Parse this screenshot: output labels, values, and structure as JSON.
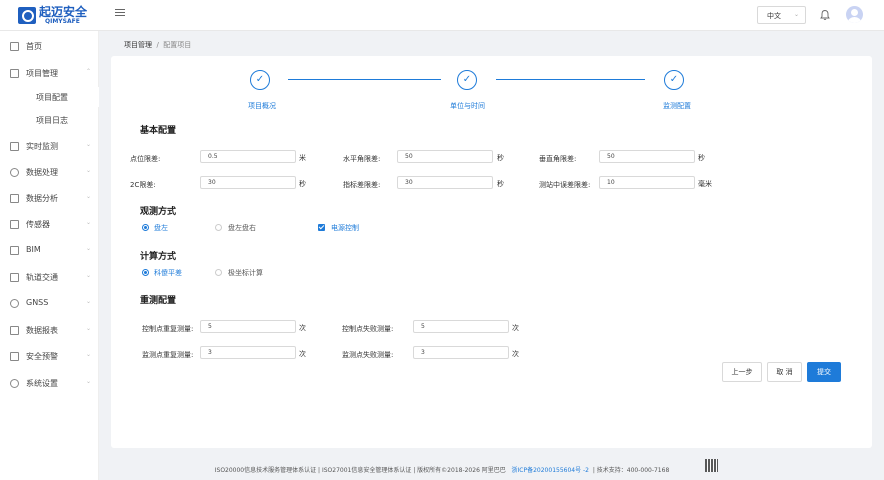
{
  "header": {
    "logo_cn": "起迈安全",
    "logo_en": "QIMYSAFE",
    "language": "中文",
    "icons": [
      "menu-toggle-icon",
      "bell-icon",
      "avatar-icon"
    ]
  },
  "sidebar": {
    "items": [
      {
        "label": "首页",
        "icon": "home-icon"
      },
      {
        "label": "项目管理",
        "icon": "project-icon",
        "expanded": true
      },
      {
        "label": "项目配置",
        "sub": true
      },
      {
        "label": "项目日志",
        "sub": true
      },
      {
        "label": "实时监测",
        "icon": "monitor-icon"
      },
      {
        "label": "数据处理",
        "icon": "data-process-icon"
      },
      {
        "label": "数据分析",
        "icon": "analysis-icon"
      },
      {
        "label": "传感器",
        "icon": "sensor-icon"
      },
      {
        "label": "BIM",
        "icon": "bim-icon"
      },
      {
        "label": "轨道交通",
        "icon": "rail-icon"
      },
      {
        "label": "GNSS",
        "icon": "gnss-icon"
      },
      {
        "label": "数据报表",
        "icon": "report-icon"
      },
      {
        "label": "安全预警",
        "icon": "warning-icon"
      },
      {
        "label": "系统设置",
        "icon": "settings-icon"
      }
    ]
  },
  "breadcrumb": {
    "root": "项目管理",
    "sep": "/",
    "current": "配置项目"
  },
  "steps": [
    {
      "label": "项目概况",
      "done": true
    },
    {
      "label": "单位与时间",
      "done": true
    },
    {
      "label": "监测配置",
      "done": true
    }
  ],
  "basic": {
    "title": "基本配置",
    "fields": [
      {
        "label": "点位限差:",
        "value": "0.5",
        "unit": "米"
      },
      {
        "label": "水平角限差:",
        "value": "50",
        "unit": "秒"
      },
      {
        "label": "垂直角限差:",
        "value": "50",
        "unit": "秒"
      },
      {
        "label": "2C限差:",
        "value": "30",
        "unit": "秒"
      },
      {
        "label": "指标差限差:",
        "value": "30",
        "unit": "秒"
      },
      {
        "label": "测站中误差限差:",
        "value": "10",
        "unit": "毫米"
      }
    ]
  },
  "observe": {
    "title": "观测方式",
    "options": [
      {
        "label": "盘左",
        "selected": true
      },
      {
        "label": "盘左盘右",
        "selected": false
      }
    ],
    "checkbox": {
      "label": "电源控制",
      "checked": true
    }
  },
  "calc": {
    "title": "计算方式",
    "options": [
      {
        "label": "科傻平差",
        "selected": true
      },
      {
        "label": "极坐标计算",
        "selected": false
      }
    ]
  },
  "remeasure": {
    "title": "重测配置",
    "fields": [
      {
        "label": "控制点重复测量:",
        "value": "5",
        "unit": "次"
      },
      {
        "label": "控制点失败测量:",
        "value": "5",
        "unit": "次"
      },
      {
        "label": "监测点重复测量:",
        "value": "3",
        "unit": "次"
      },
      {
        "label": "监测点失败测量:",
        "value": "3",
        "unit": "次"
      }
    ]
  },
  "buttons": {
    "prev": "上一步",
    "cancel": "取 消",
    "submit": "提交"
  },
  "footer": {
    "text": "ISO20000信息技术服务管理体系认证 | ISO27001信息安全管理体系认证 | 版权所有©2018-2026 阿里巴巴",
    "icp": "浙ICP备20200155604号 -2",
    "support": "| 技术支持：400-000-7168"
  },
  "colors": {
    "accent": "#1e7bd9",
    "brand": "#1f5fbf"
  }
}
